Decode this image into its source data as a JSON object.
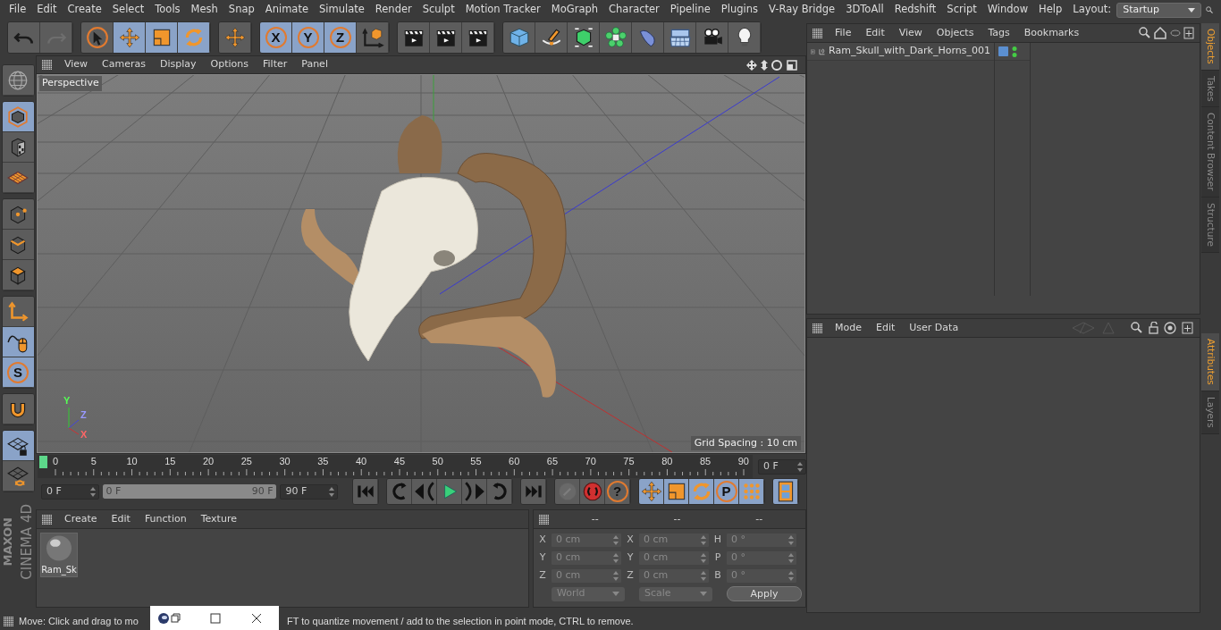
{
  "menu_bar": {
    "items": [
      "File",
      "Edit",
      "Create",
      "Select",
      "Tools",
      "Mesh",
      "Snap",
      "Animate",
      "Simulate",
      "Render",
      "Sculpt",
      "Motion Tracker",
      "MoGraph",
      "Character",
      "Pipeline",
      "Plugins",
      "V-Ray Bridge",
      "3DToAll",
      "Redshift",
      "Script",
      "Window",
      "Help"
    ],
    "layout_label": "Layout:",
    "layout_value": "Startup"
  },
  "toolbar": {
    "groups": [
      {
        "tools": [
          {
            "selected": false,
            "disabled": false
          },
          {
            "selected": false,
            "disabled": true
          }
        ]
      },
      {
        "tools": [
          {
            "selected": false,
            "disabled": false
          },
          {
            "selected": true,
            "disabled": false
          },
          {
            "selected": true,
            "disabled": false
          },
          {
            "selected": true,
            "disabled": false
          }
        ]
      },
      {
        "tools": [
          {
            "selected": false,
            "disabled": false
          }
        ]
      },
      {
        "tools": [
          {
            "label": "X",
            "selected": true,
            "disabled": false
          },
          {
            "label": "Y",
            "selected": true,
            "disabled": false
          },
          {
            "label": "Z",
            "selected": true,
            "disabled": false
          },
          {
            "selected": false,
            "disabled": false
          }
        ]
      },
      {
        "tools": [
          {
            "selected": false,
            "disabled": false
          },
          {
            "selected": false,
            "disabled": false
          },
          {
            "selected": false,
            "disabled": false
          }
        ]
      },
      {
        "tools": [
          {
            "selected": false,
            "disabled": false
          },
          {
            "selected": false,
            "disabled": false
          },
          {
            "selected": false,
            "disabled": false
          },
          {
            "selected": false,
            "disabled": false
          },
          {
            "selected": false,
            "disabled": false
          },
          {
            "selected": false,
            "disabled": false
          },
          {
            "selected": false,
            "disabled": false
          },
          {
            "selected": false,
            "disabled": false
          }
        ]
      }
    ]
  },
  "left_toolbar": {
    "groups": [
      {
        "tools": [
          {
            "selected": false,
            "disabled": false
          }
        ]
      },
      {
        "tools": [
          {
            "selected": true,
            "disabled": false
          },
          {
            "selected": false,
            "disabled": false
          },
          {
            "selected": false,
            "disabled": false
          }
        ]
      },
      {
        "tools": [
          {
            "selected": false,
            "disabled": false
          },
          {
            "selected": false,
            "disabled": false
          },
          {
            "selected": false,
            "disabled": false
          }
        ]
      },
      {
        "tools": [
          {
            "selected": false,
            "disabled": false
          },
          {
            "selected": true,
            "disabled": false
          },
          {
            "label": "S",
            "selected": true,
            "disabled": false
          }
        ]
      },
      {
        "tools": [
          {
            "selected": false,
            "disabled": false
          }
        ]
      },
      {
        "tools": [
          {
            "selected": true,
            "disabled": false
          },
          {
            "selected": false,
            "disabled": false
          }
        ]
      }
    ]
  },
  "viewport": {
    "menu": [
      "View",
      "Cameras",
      "Display",
      "Options",
      "Filter",
      "Panel"
    ],
    "camera": "Perspective",
    "grid_spacing": "Grid Spacing : 10 cm",
    "axis_labels": [
      "Y",
      "Z",
      "X"
    ]
  },
  "timeline": {
    "ruler_labels": [
      "0",
      "5",
      "10",
      "15",
      "20",
      "25",
      "30",
      "35",
      "40",
      "45",
      "50",
      "55",
      "60",
      "65",
      "70",
      "75",
      "80",
      "85",
      "90"
    ],
    "current_frame": "0 F",
    "start_field": "0 F",
    "range": {
      "start": "0 F",
      "end": "90 F",
      "level": 1
    },
    "end_field": "90 F",
    "groups": [
      {
        "tools": [
          {
            "selected": false,
            "disabled": false
          }
        ]
      },
      {
        "tools": [
          {
            "selected": false,
            "disabled": false
          },
          {
            "selected": false,
            "disabled": false
          },
          {
            "selected": false,
            "disabled": false
          },
          {
            "selected": false,
            "disabled": false
          },
          {
            "selected": false,
            "disabled": false
          }
        ]
      },
      {
        "tools": [
          {
            "selected": false,
            "disabled": false
          }
        ]
      },
      {
        "tools": [
          {
            "selected": false,
            "disabled": true
          },
          {
            "selected": false,
            "disabled": false
          },
          {
            "label": "?",
            "selected": false,
            "disabled": false
          }
        ]
      },
      {
        "tools": [
          {
            "selected": true,
            "disabled": false
          },
          {
            "selected": true,
            "disabled": false
          },
          {
            "selected": true,
            "disabled": false
          },
          {
            "label": "P",
            "selected": true,
            "disabled": false
          },
          {
            "selected": true,
            "disabled": false
          }
        ]
      },
      {
        "tools": [
          {
            "selected": true,
            "disabled": false
          }
        ]
      }
    ]
  },
  "material_manager": {
    "menu": [
      "Create",
      "Edit",
      "Function",
      "Texture"
    ],
    "materials": [
      {
        "name": "Ram_Sk",
        "selected": false
      }
    ]
  },
  "coordinates": {
    "headers": [
      "--",
      "--",
      "--"
    ],
    "rows": [
      {
        "position_label": "X",
        "position": "0 cm",
        "size_label": "X",
        "size": "0 cm",
        "rotation_label": "H",
        "rotation": "0 °"
      },
      {
        "position_label": "Y",
        "position": "0 cm",
        "size_label": "Y",
        "size": "0 cm",
        "rotation_label": "P",
        "rotation": "0 °"
      },
      {
        "position_label": "Z",
        "position": "0 cm",
        "size_label": "Z",
        "size": "0 cm",
        "rotation_label": "B",
        "rotation": "0 °"
      }
    ],
    "mode_dropdown": "World",
    "size_dropdown": "Scale",
    "apply": "Apply"
  },
  "logo": {
    "brand": "MAXON",
    "product": "CINEMA 4D"
  },
  "object_manager": {
    "menu": [
      "File",
      "Edit",
      "View",
      "Objects",
      "Tags",
      "Bookmarks"
    ],
    "objects": [
      {
        "name": "Ram_Skull_with_Dark_Horns_001",
        "expanded": false,
        "selected": false,
        "color": "#5b8fd0"
      }
    ]
  },
  "attribute_manager": {
    "menu": [
      "Mode",
      "Edit",
      "User Data"
    ]
  },
  "side_tabs": {
    "top": [
      {
        "label": "Objects",
        "selected": true
      },
      {
        "label": "Takes",
        "selected": false
      },
      {
        "label": "Content Browser",
        "selected": false
      },
      {
        "label": "Structure",
        "selected": false
      }
    ],
    "bottom": [
      {
        "label": "Attributes",
        "selected": true
      },
      {
        "label": "Layers",
        "selected": false
      }
    ]
  },
  "status_bar": {
    "text_before": "Move: Click and drag to mo",
    "text_after": "FT to quantize movement / add to the selection in point mode, CTRL to remove."
  }
}
